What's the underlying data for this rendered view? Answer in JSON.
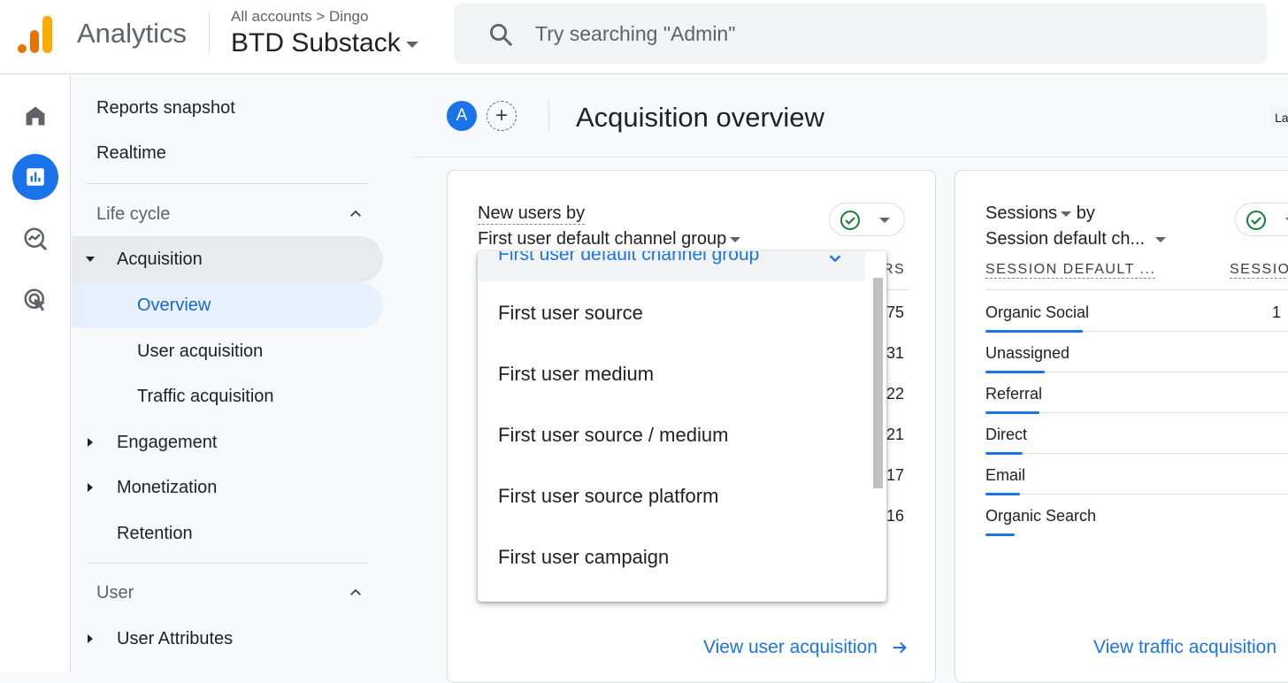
{
  "header": {
    "app_name": "Analytics",
    "breadcrumb": "All accounts > Dingo",
    "property": "BTD Substack",
    "search_placeholder": "Try searching \"Admin\""
  },
  "rail": {
    "items": [
      "home-icon",
      "reports-icon",
      "explore-icon",
      "advertising-icon"
    ]
  },
  "sidenav": {
    "reports_snapshot": "Reports snapshot",
    "realtime": "Realtime",
    "lifecycle": "Life cycle",
    "acquisition": "Acquisition",
    "overview": "Overview",
    "user_acquisition": "User acquisition",
    "traffic_acquisition": "Traffic acquisition",
    "engagement": "Engagement",
    "monetization": "Monetization",
    "retention": "Retention",
    "user": "User",
    "user_attributes": "User Attributes"
  },
  "main": {
    "avatar": "A",
    "add_comparison": "+",
    "title": "Acquisition overview",
    "cutoff_button": "La"
  },
  "card1": {
    "line1": "New users by",
    "line2": "First user default channel group",
    "col_header_cut": "RS",
    "values_cut": [
      "75",
      "31",
      "22",
      "21",
      "17",
      "16"
    ],
    "link": "View user acquisition"
  },
  "card2": {
    "line1_metric": "Sessions",
    "line1_by": "by",
    "line2": "Session default ch...",
    "col_header_1": "SESSION DEFAULT ...",
    "col_header_2": "SESSIO",
    "value_cut": "1",
    "rows": [
      {
        "label": "Organic Social",
        "bar": 1.0
      },
      {
        "label": "Unassigned",
        "bar": 0.61
      },
      {
        "label": "Referral",
        "bar": 0.55
      },
      {
        "label": "Direct",
        "bar": 0.38
      },
      {
        "label": "Email",
        "bar": 0.35
      },
      {
        "label": "Organic Search",
        "bar": 0.3
      }
    ],
    "link": "View traffic acquisition"
  },
  "dropdown": {
    "selected": "First user default channel group",
    "options": [
      "First user source",
      "First user medium",
      "First user source / medium",
      "First user source platform",
      "First user campaign"
    ]
  },
  "colors": {
    "accent": "#1a73e8",
    "selected_bg": "#e8f0fe",
    "check_green": "#188038",
    "logo_orange": "#f9ab00",
    "logo_dark_orange": "#e37400"
  }
}
